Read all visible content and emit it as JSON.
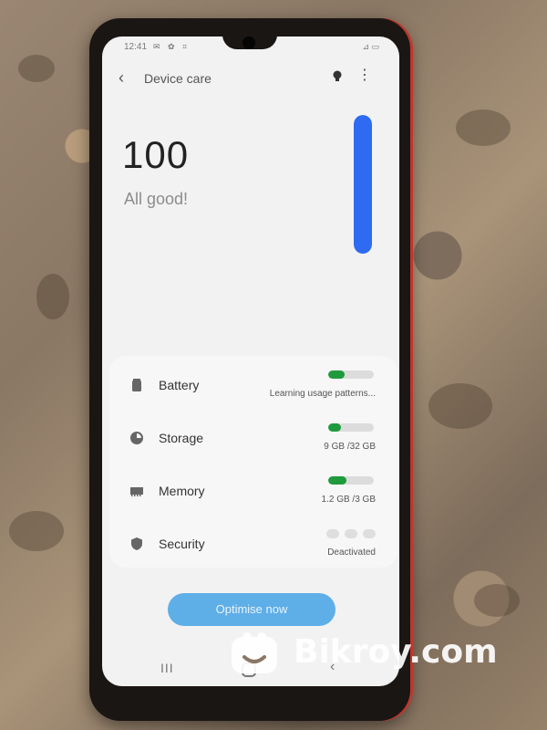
{
  "status_bar": {
    "time": "12:41",
    "icons": "✉ ✿ ⌗",
    "right": "⊿ ▭"
  },
  "header": {
    "title": "Device care",
    "back_icon": "chevron-left-icon",
    "tips_icon": "lightbulb-icon",
    "more_icon": "more-vertical-icon"
  },
  "score": {
    "value": "100",
    "status": "All good!",
    "fill_fraction": 1.0,
    "bar_color": "#2f6bf2"
  },
  "items": [
    {
      "label": "Battery",
      "value": "Learning usage patterns...",
      "icon": "battery-icon",
      "level": 0.35
    },
    {
      "label": "Storage",
      "value": "9 GB /32 GB",
      "icon": "storage-pie-icon",
      "level": 0.28
    },
    {
      "label": "Memory",
      "value": "1.2 GB /3 GB",
      "icon": "memory-chip-icon",
      "level": 0.4
    },
    {
      "label": "Security",
      "value": "Deactivated",
      "icon": "shield-icon"
    }
  ],
  "accent_green": "#1f9a3c",
  "optimise_button": {
    "label": "Optimise now"
  },
  "nav": {
    "recent": "III",
    "back": "‹"
  },
  "watermark": {
    "text": "Bikroy.com"
  }
}
